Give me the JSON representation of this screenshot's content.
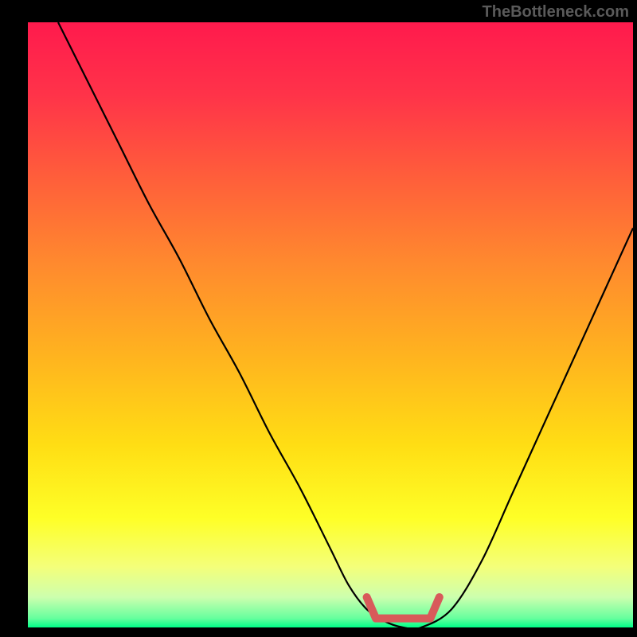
{
  "attribution": "TheBottleneck.com",
  "colors": {
    "background": "#000000",
    "gradient_stops": [
      {
        "offset": 0.0,
        "color": "#ff1a4d"
      },
      {
        "offset": 0.12,
        "color": "#ff3349"
      },
      {
        "offset": 0.25,
        "color": "#ff5c3b"
      },
      {
        "offset": 0.4,
        "color": "#ff8a2e"
      },
      {
        "offset": 0.55,
        "color": "#ffb31f"
      },
      {
        "offset": 0.7,
        "color": "#ffde14"
      },
      {
        "offset": 0.82,
        "color": "#feff27"
      },
      {
        "offset": 0.9,
        "color": "#f4ff7a"
      },
      {
        "offset": 0.95,
        "color": "#cdffae"
      },
      {
        "offset": 0.985,
        "color": "#66ff9e"
      },
      {
        "offset": 1.0,
        "color": "#00ff88"
      }
    ],
    "curve": "#000000",
    "marker": "#d85a5a",
    "attribution_text": "#5a5a5a"
  },
  "chart_data": {
    "type": "line",
    "title": "",
    "xlabel": "",
    "ylabel": "",
    "xlim": [
      0,
      100
    ],
    "ylim": [
      0,
      100
    ],
    "grid": false,
    "legend": false,
    "series": [
      {
        "name": "bottleneck-curve",
        "x": [
          5,
          10,
          15,
          20,
          25,
          30,
          35,
          40,
          45,
          50,
          53,
          56,
          59,
          62,
          65,
          70,
          75,
          80,
          85,
          90,
          95,
          100
        ],
        "y": [
          100,
          90,
          80,
          70,
          61,
          51,
          42,
          32,
          23,
          13,
          7,
          3,
          1,
          0,
          0,
          3,
          11,
          22,
          33,
          44,
          55,
          66
        ]
      }
    ],
    "flat_region": {
      "x_start": 56,
      "x_end": 68,
      "y": 1.5
    }
  }
}
